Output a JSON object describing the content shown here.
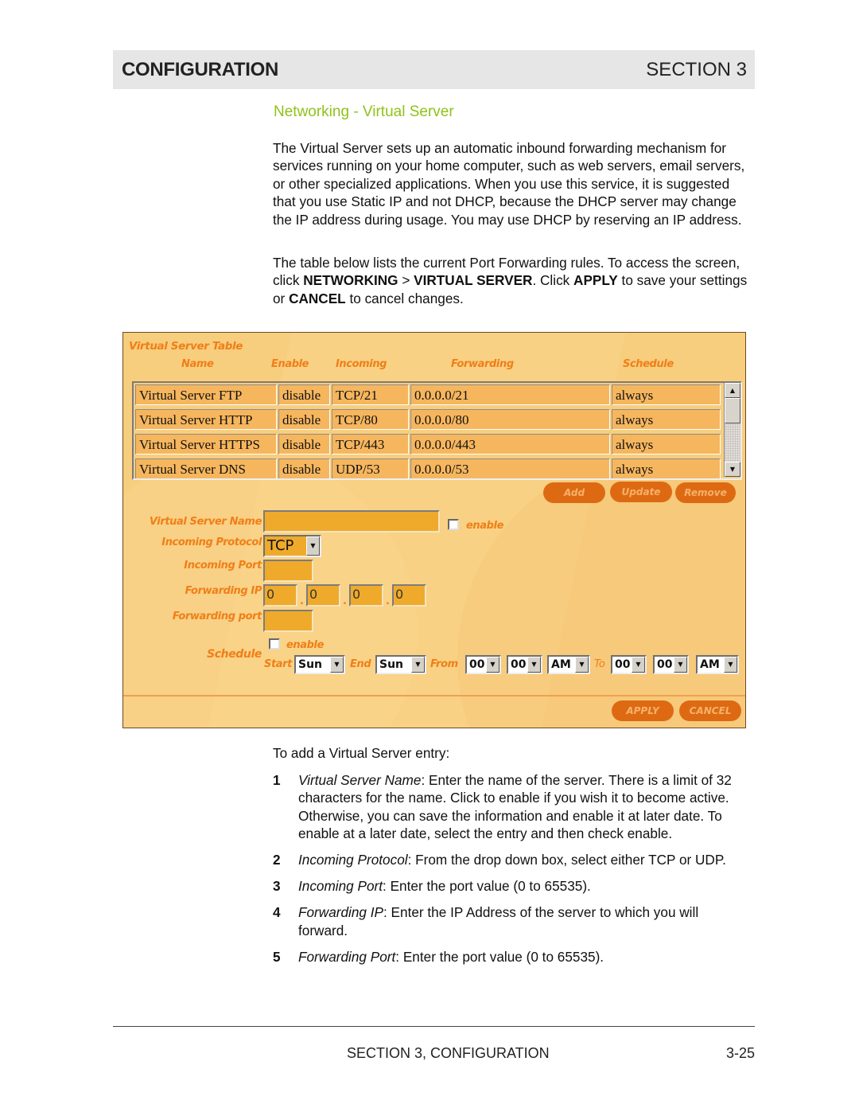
{
  "header": {
    "left": "CONFIGURATION",
    "right": "SECTION 3"
  },
  "subtitle": "Networking - Virtual Server",
  "paragraphs": {
    "p1": "The Virtual Server sets up an automatic inbound forwarding mechanism for services running on your home computer, such as web servers, email servers, or other specialized applications. When you use this service, it is suggested that you use Static IP and not DHCP, because the DHCP server may change the IP address during usage. You may use DHCP by reserving an IP address.",
    "p2_a": "The table below lists the current Port Forwarding rules. To access the screen, click ",
    "p2_networking": "NETWORKING",
    "p2_gt": " > ",
    "p2_vs": "VIRTUAL SERVER",
    "p2_b": ". Click ",
    "p2_apply": "APPLY",
    "p2_c": " to save your settings or ",
    "p2_cancel": "CANCEL",
    "p2_d": " to cancel changes."
  },
  "panel": {
    "table_title": "Virtual Server Table",
    "columns": [
      "Name",
      "Enable",
      "Incoming",
      "Forwarding",
      "Schedule"
    ],
    "rows": [
      [
        "Virtual Server FTP",
        "disable",
        "TCP/21",
        "0.0.0.0/21",
        "always"
      ],
      [
        "Virtual Server HTTP",
        "disable",
        "TCP/80",
        "0.0.0.0/80",
        "always"
      ],
      [
        "Virtual Server HTTPS",
        "disable",
        "TCP/443",
        "0.0.0.0/443",
        "always"
      ],
      [
        "Virtual Server DNS",
        "disable",
        "UDP/53",
        "0.0.0.0/53",
        "always"
      ]
    ],
    "buttons": {
      "add": "Add",
      "update": "Update",
      "remove": "Remove",
      "apply": "APPLY",
      "cancel": "CANCEL"
    },
    "form": {
      "name_label": "Virtual Server Name",
      "name_value": "",
      "enable_label": "enable",
      "protocol_label": "Incoming Protocol",
      "protocol_value": "TCP",
      "in_port_label": "Incoming Port",
      "in_port_value": "",
      "fwd_ip_label": "Forwarding IP",
      "fwd_ip": [
        "0",
        "0",
        "0",
        "0"
      ],
      "fwd_port_label": "Forwarding port",
      "fwd_port_value": "",
      "schedule_label": "Schedule",
      "schedule_enable_label": "enable",
      "start_label": "Start",
      "start_value": "Sun",
      "end_label": "End",
      "end_value": "Sun",
      "from_label": "From",
      "from_hour": "00",
      "from_min": "00",
      "from_ampm": "AM",
      "to_label": "To",
      "to_hour": "00",
      "to_min": "00",
      "to_ampm": "AM"
    }
  },
  "instructions": {
    "intro": "To add a Virtual Server entry:",
    "steps": [
      {
        "num": "1",
        "term": "Virtual Server Name",
        "text": ": Enter the name of the server. There is a limit of 32 characters for the name. Click to enable if you wish it to become active. Otherwise, you can save the information and enable it at later date. To enable at a later date, select the entry and then check enable."
      },
      {
        "num": "2",
        "term": "Incoming Protocol",
        "text": ": From the drop down box, select either TCP or UDP."
      },
      {
        "num": "3",
        "term": "Incoming Port",
        "text": ": Enter the port value (0 to 65535)."
      },
      {
        "num": "4",
        "term": "Forwarding IP",
        "text": ": Enter the IP Address of the server to which you will forward."
      },
      {
        "num": "5",
        "term": "Forwarding Port",
        "text": ": Enter the port value (0 to 65535)."
      }
    ]
  },
  "footer": {
    "section": "SECTION 3, CONFIGURATION",
    "page": "3-25"
  }
}
